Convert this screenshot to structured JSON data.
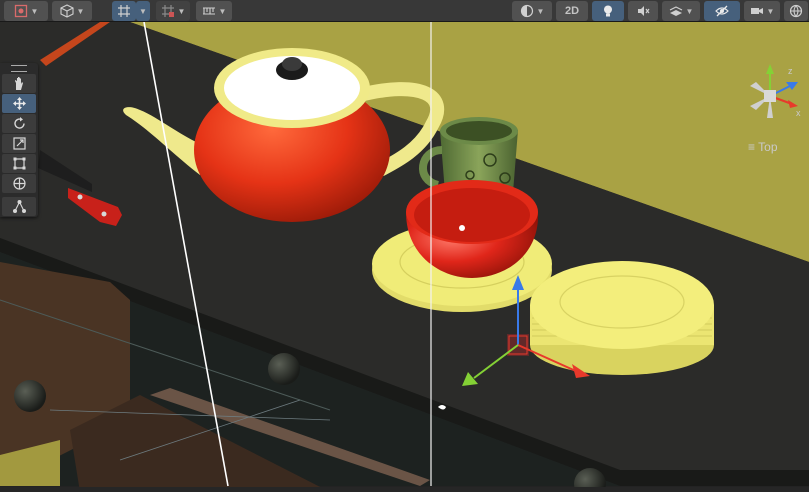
{
  "toolbar": {
    "two_d_label": "2D",
    "items": [
      {
        "name": "draw-mode-button",
        "icon": "shading-mode-icon"
      },
      {
        "name": "gizmo-object-button",
        "icon": "cube-icon"
      },
      {
        "name": "grid-snap-button",
        "icon": "grid-snap-icon"
      },
      {
        "name": "increment-snap-button",
        "icon": "increment-snap-icon"
      },
      {
        "name": "ruler-button",
        "icon": "ruler-icon"
      },
      {
        "name": "render-mode-button",
        "icon": "render-mode-icon"
      },
      {
        "name": "lighting-button",
        "icon": "lightbulb-icon"
      },
      {
        "name": "audio-button",
        "icon": "mute-icon"
      },
      {
        "name": "effects-button",
        "icon": "effects-icon"
      },
      {
        "name": "visibility-button",
        "icon": "eye-slash-icon"
      },
      {
        "name": "camera-button",
        "icon": "camera-icon"
      },
      {
        "name": "gizmos-button",
        "icon": "globe-icon"
      }
    ]
  },
  "tools": [
    {
      "name": "hand-tool",
      "icon": "hand-icon"
    },
    {
      "name": "move-tool",
      "icon": "move-icon",
      "active": true
    },
    {
      "name": "rotate-tool",
      "icon": "rotate-icon"
    },
    {
      "name": "scale-tool",
      "icon": "scale-icon"
    },
    {
      "name": "rect-tool",
      "icon": "rect-icon"
    },
    {
      "name": "transform-tool",
      "icon": "transform-icon"
    },
    {
      "name": "custom-tool",
      "icon": "custom-editor-icon"
    }
  ],
  "orientation": {
    "view_label": "Top",
    "x_axis": "x",
    "z_axis": "z"
  },
  "colors": {
    "teapot": "#e53316",
    "plate": "#f0ec78",
    "counter": "#2a2a28",
    "wall": "#a9a244",
    "selected_tool": "#46607c",
    "x_axis": "#e8392b",
    "y_axis": "#84d135",
    "z_axis": "#3a7ae8"
  }
}
